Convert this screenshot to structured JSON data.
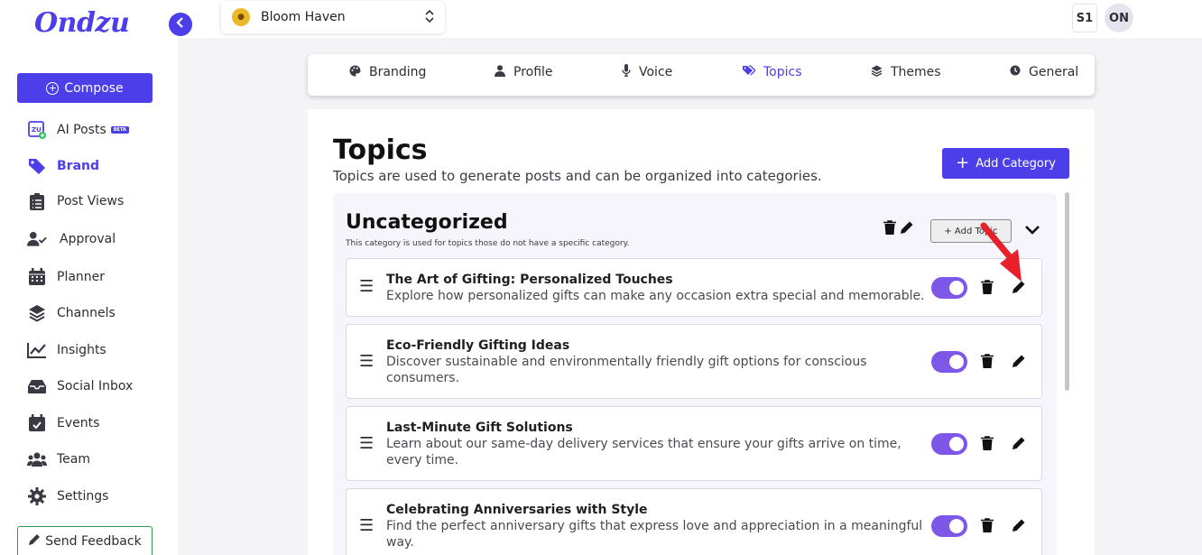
{
  "app": {
    "logo": "Ondzu"
  },
  "sidebar": {
    "compose_label": "Compose",
    "items": [
      {
        "label": "AI Posts",
        "icon": "ai-posts-icon",
        "badge": "BETA"
      },
      {
        "label": "Brand",
        "icon": "tag-icon",
        "active": true
      },
      {
        "label": "Post Views",
        "icon": "clipboard-list-icon"
      },
      {
        "label": "Approval",
        "icon": "user-check-icon"
      },
      {
        "label": "Planner",
        "icon": "calendar-icon"
      },
      {
        "label": "Channels",
        "icon": "layers-icon"
      },
      {
        "label": "Insights",
        "icon": "chart-line-icon"
      },
      {
        "label": "Social Inbox",
        "icon": "inbox-icon"
      },
      {
        "label": "Events",
        "icon": "calendar-check-icon"
      },
      {
        "label": "Team",
        "icon": "users-icon"
      },
      {
        "label": "Settings",
        "icon": "gear-icon"
      }
    ],
    "feedback_label": "Send Feedback"
  },
  "header": {
    "brand_name": "Bloom Haven",
    "workspace_badge": "S1",
    "user_initials": "ON"
  },
  "tabs": [
    {
      "label": "Branding",
      "icon": "palette-icon"
    },
    {
      "label": "Profile",
      "icon": "user-icon"
    },
    {
      "label": "Voice",
      "icon": "microphone-icon"
    },
    {
      "label": "Topics",
      "icon": "tags-icon",
      "active": true
    },
    {
      "label": "Themes",
      "icon": "layers-icon"
    },
    {
      "label": "General",
      "icon": "clock-icon"
    }
  ],
  "main": {
    "title": "Topics",
    "subtitle": "Topics are used to generate posts and can be organized into categories.",
    "add_category_label": "Add Category",
    "category": {
      "title": "Uncategorized",
      "description": "This category is used for topics those do not have a specific category.",
      "add_topic_label": "+ Add Topic",
      "topics": [
        {
          "title": "The Art of Gifting: Personalized Touches",
          "description": "Explore how personalized gifts can make any occasion extra special and memorable.",
          "enabled": true
        },
        {
          "title": "Eco-Friendly Gifting Ideas",
          "description": "Discover sustainable and environmentally friendly gift options for conscious consumers.",
          "enabled": true
        },
        {
          "title": "Last-Minute Gift Solutions",
          "description": "Learn about our same-day delivery services that ensure your gifts arrive on time, every time.",
          "enabled": true
        },
        {
          "title": "Celebrating Anniversaries with Style",
          "description": "Find the perfect anniversary gifts that express love and appreciation in a meaningful way.",
          "enabled": true
        }
      ]
    }
  },
  "colors": {
    "accent": "#4c3ee8",
    "toggle_on": "#7c57e8",
    "annotation_arrow": "#e8202a"
  }
}
